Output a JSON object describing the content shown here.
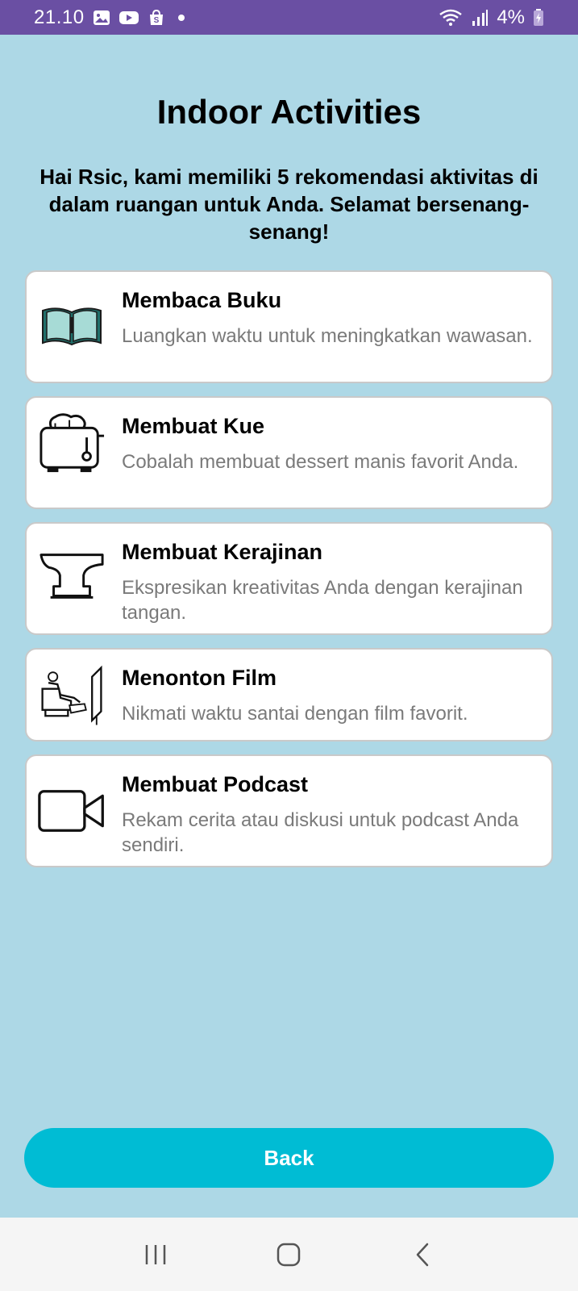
{
  "status_bar": {
    "time": "21.10",
    "battery": "4%",
    "icons": [
      "gallery-icon",
      "youtube-icon",
      "shopee-icon",
      "wifi-icon",
      "signal-icon",
      "battery-icon"
    ]
  },
  "page": {
    "title": "Indoor Activities",
    "subtitle": "Hai Rsic, kami memiliki 5 rekomendasi aktivitas di dalam ruangan untuk Anda. Selamat bersenang-senang!"
  },
  "activities": [
    {
      "title": "Membaca Buku",
      "description": "Luangkan waktu untuk meningkatkan wawasan.",
      "icon": "book-icon"
    },
    {
      "title": "Membuat Kue",
      "description": "Cobalah membuat dessert manis favorit Anda.",
      "icon": "toaster-icon"
    },
    {
      "title": "Membuat Kerajinan",
      "description": "Ekspresikan kreativitas Anda dengan kerajinan tangan.",
      "icon": "anvil-icon"
    },
    {
      "title": "Menonton Film",
      "description": "Nikmati waktu santai dengan film favorit.",
      "icon": "movie-watching-icon"
    },
    {
      "title": "Membuat Podcast",
      "description": "Rekam cerita atau diskusi untuk podcast Anda sendiri.",
      "icon": "video-camera-icon"
    }
  ],
  "back_button": {
    "label": "Back"
  },
  "nav_bar": {
    "icons": [
      "recent-apps-icon",
      "home-icon",
      "back-nav-icon"
    ]
  },
  "colors": {
    "status_bar": "#6a4fa3",
    "background": "#add8e6",
    "button": "#00bcd4",
    "card": "#ffffff",
    "description_text": "#7a7a7a"
  }
}
